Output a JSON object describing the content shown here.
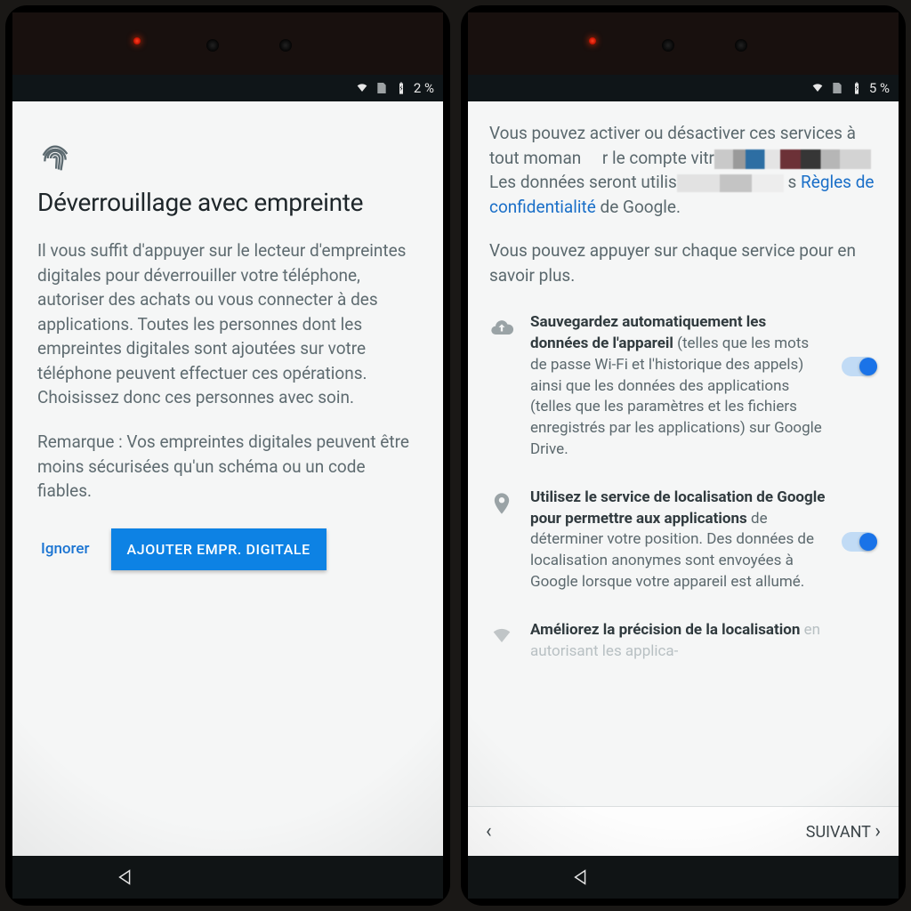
{
  "left": {
    "status": {
      "battery": "2 %"
    },
    "title": "Déverrouillage avec empreinte",
    "paragraph": "Il vous suffit d'appuyer sur le lecteur d'empreintes digitales pour déverrouiller votre téléphone, autoriser des achats ou vous connecter à des applications. Toutes les personnes dont les empreintes digitales sont ajoutées sur votre téléphone peuvent effectuer ces opérations. Choisissez donc ces personnes avec soin.",
    "remark": "Remarque : Vos empreintes digitales peuvent être moins sécurisées qu'un schéma ou un code fiables.",
    "skip_label": "Ignorer",
    "primary_label": "AJOUTER EMPR. DIGITALE"
  },
  "right": {
    "status": {
      "battery": "5 %"
    },
    "intro_pre_redact": "Vous pouvez activer ou désactiver ces services à tout mom",
    "intro_mid1": "r le compte vitr",
    "intro_mid2": "Les données seront utilis",
    "intro_link_pre": "s ",
    "intro_link": "Règles de confidentialité",
    "intro_post_link": " de Google.",
    "intro_tap": "Vous pouvez appuyer sur chaque service pour en savoir plus.",
    "services": [
      {
        "icon": "cloud-upload-icon",
        "bold": "Sauvegardez automatiquement les données de l'appareil",
        "rest": " (telles que les mots de passe Wi-Fi et l'historique des appels) ainsi que les données des applications (telles que les paramètres et les fichiers enregistrés par les applications) sur Google Drive.",
        "on": true
      },
      {
        "icon": "location-pin-icon",
        "bold": "Utilisez le service de localisation de Google pour permettre aux applications",
        "rest": " de déterminer votre position. Des données de localisation anonymes sont envoyées à Google lorsque votre appareil est allumé.",
        "on": true
      },
      {
        "icon": "wifi-dim-icon",
        "bold": "Améliorez la précision de la localisation",
        "rest": " en autorisant les applica-"
      }
    ],
    "next_label": "SUIVANT"
  }
}
